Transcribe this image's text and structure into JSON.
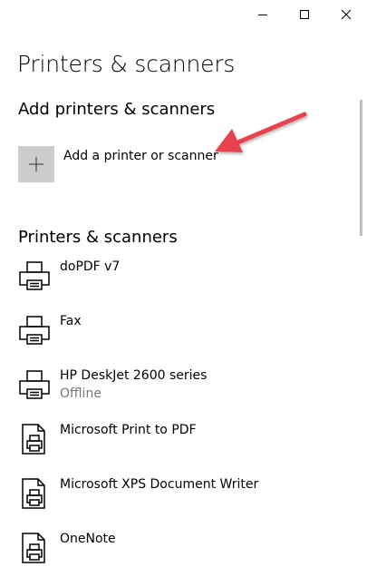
{
  "window": {
    "controls": [
      "minimize-icon",
      "maximize-icon",
      "close-icon"
    ]
  },
  "page": {
    "title": "Printers & scanners"
  },
  "add_section": {
    "heading": "Add printers & scanners",
    "button_label": "Add a printer or scanner",
    "tile_icon": "plus-icon"
  },
  "list_section": {
    "heading": "Printers & scanners",
    "items": [
      {
        "name": "doPDF v7",
        "status": "",
        "icon": "printer-icon"
      },
      {
        "name": "Fax",
        "status": "",
        "icon": "printer-icon"
      },
      {
        "name": "HP DeskJet 2600 series",
        "status": "Offline",
        "icon": "printer-icon"
      },
      {
        "name": "Microsoft Print to PDF",
        "status": "",
        "icon": "document-printer-icon"
      },
      {
        "name": "Microsoft XPS Document Writer",
        "status": "",
        "icon": "document-printer-icon"
      },
      {
        "name": "OneNote",
        "status": "",
        "icon": "document-printer-icon"
      }
    ]
  },
  "colors": {
    "tile": "#cccccc",
    "arrow": "#e8434f",
    "secondary_text": "#767676"
  }
}
